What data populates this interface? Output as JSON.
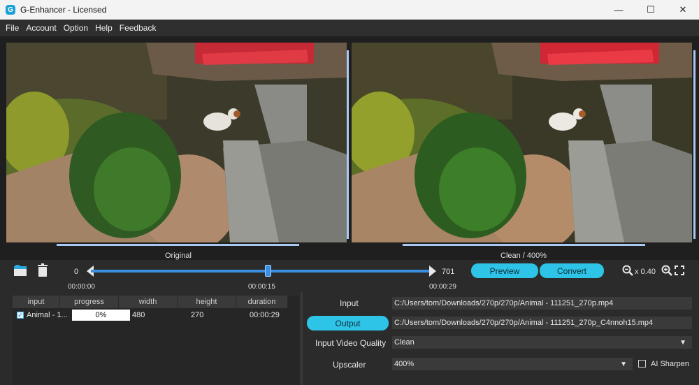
{
  "window": {
    "title": "G-Enhancer - Licensed",
    "logo_letter": "G",
    "minimize": "—",
    "maximize": "☐",
    "close": "✕"
  },
  "menu": [
    "File",
    "Account",
    "Option",
    "Help",
    "Feedback"
  ],
  "preview": {
    "left_label": "Original",
    "right_label": "Clean / 400%"
  },
  "timeline": {
    "start_frame": "0",
    "end_frame": "701",
    "start_time": "00:00:00",
    "current_time": "00:00:15",
    "end_time": "00:00:29",
    "position_fraction": 0.52
  },
  "buttons": {
    "preview": "Preview",
    "convert": "Convert"
  },
  "zoom": {
    "level": "x 0.40"
  },
  "table": {
    "columns": [
      "input",
      "progress",
      "width",
      "height",
      "duration"
    ],
    "rows": [
      {
        "input": "Animal - 1...",
        "progress": "0%",
        "width": "480",
        "height": "270",
        "duration": "00:00:29",
        "checked": true
      }
    ]
  },
  "settings": {
    "input_label": "Input",
    "input_path": "C:/Users/tom/Downloads/270p/270p/Animal - 111251_270p.mp4",
    "output_button": "Output",
    "output_path": "C:/Users/tom/Downloads/270p/270p/Animal - 111251_270p_C4nnoh15.mp4",
    "quality_label": "Input Video Quality",
    "quality_value": "Clean",
    "upscaler_label": "Upscaler",
    "upscaler_value": "400%",
    "ai_sharpen_label": "AI Sharpen",
    "ai_sharpen_checked": false
  },
  "colors": {
    "accent": "#2ec4e8",
    "track": "#3b8fe0",
    "bg": "#2b2b2b"
  }
}
